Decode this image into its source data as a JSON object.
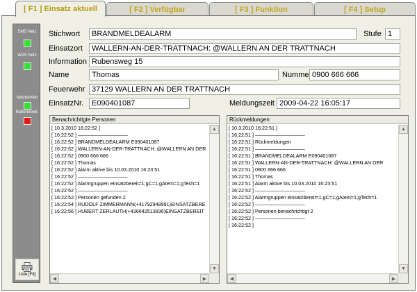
{
  "tabs": [
    {
      "label": "[ F1 ] Einsatz aktuell",
      "active": true
    },
    {
      "label": "[ F2 ] Verfügbar",
      "active": false
    },
    {
      "label": "[ F3 ] Funktion",
      "active": false
    },
    {
      "label": "[ F4 ] Setup",
      "active": false
    }
  ],
  "status": {
    "sms_label": "SMS Netz",
    "was_label": "WAS Netz",
    "netz_label": "Netzbetrieb",
    "batterie_label": "Batteriebetr.",
    "sms_color": "#35e035",
    "was_color": "#35e035",
    "netz_color": "#35e035",
    "batterie_color": "#e01818",
    "liste_button": "Liste [F8]",
    "liste_icon": "printer-icon"
  },
  "form": {
    "stichwort_label": "Stichwort",
    "stichwort": "BRANDMELDEALARM",
    "stufe_label": "Stufe",
    "stufe": "1",
    "einsatzort_label": "Einsatzort",
    "einsatzort": "WALLERN-AN-DER-TRATTNACH: @WALLERN AN DER  TRATTNACH",
    "information_label": "Information",
    "information": "Rubensweg 15",
    "name_label": "Name",
    "name": "Thomas",
    "nummer_label": "Nummer",
    "nummer": "0900 666 666",
    "feuerwehr_label": "Feuerwehr",
    "feuerwehr": "37129 WALLERN AN DER  TRATTNACH",
    "einsatznr_label": "EinsatzNr.",
    "einsatznr": "E090401087",
    "meldungszeit_label": "Meldungszeit",
    "meldungszeit": "2009-04-22 16:05:17"
  },
  "lists": {
    "benachrichtigte": {
      "header": "Benachrichtigte Personen",
      "rows": [
        "[ 10.3.2010 16:22:52 ]",
        "[ 16:22:52 ] ——————————",
        "[ 16:22:52 ] BRANDMELDEALARM E090401087",
        "[ 16:22:52 ] WALLERN-AN-DER-TRATTNACH: @WALLERN AN DER",
        "[ 16:22:52 ] 0900 666 666",
        "[ 16:22:52 ] Thomas",
        "[ 16:22:52 ] Alarm aktive bis 10.03.2010 16:23:51",
        "[ 16:22:52 ] ——————————",
        "[ 16:22:52 ] Alarmgruppen einsatzbereit=1;gC=1;gAtem=1;gTech=1",
        "[ 16:22:52 ] ——————————",
        "[ 16:22:52 ] Personen gefunden 2",
        "[ 16:22:54 ] RUDOLF ZIMMERMANN(+41792948991)EINSATZBERE",
        "[ 16:22:56 ] HUBERT ZERLAUTH(+436642513836)EINSATZBEREIT"
      ]
    },
    "rueckmeldungen": {
      "header": "Rückmeldungen",
      "rows": [
        "[ 10.3.2010 16:22:51 ]",
        "[ 16:22:51 ] ——————————",
        "[ 16:22:51 ]       Rückmeldungen",
        "[ 16:22:51 ] ——————————",
        "[ 16:22:51 ] BRANDMELDEALARM E090401087",
        "[ 16:22:51 ] WALLERN-AN-DER-TRATTNACH: @WALLERN AN DER",
        "[ 16:22:51 ] 0900 666 666",
        "[ 16:22:51 ] Thomas",
        "[ 16:22:51 ] Alarm aktive bis 10.03.2010 16:23:51",
        "[ 16:22:52 ] ——————————",
        "[ 16:22:52 ] Alarmgruppen einsatzbereit=1;gC=1;gAtem=1;gTech=1",
        "[ 16:22:52 ] ——————————",
        "[ 16:22:52 ] Personen benachrichtigt 2",
        "[ 16:22:52 ] ——————————",
        "[ 16:22:52 ]"
      ]
    }
  }
}
